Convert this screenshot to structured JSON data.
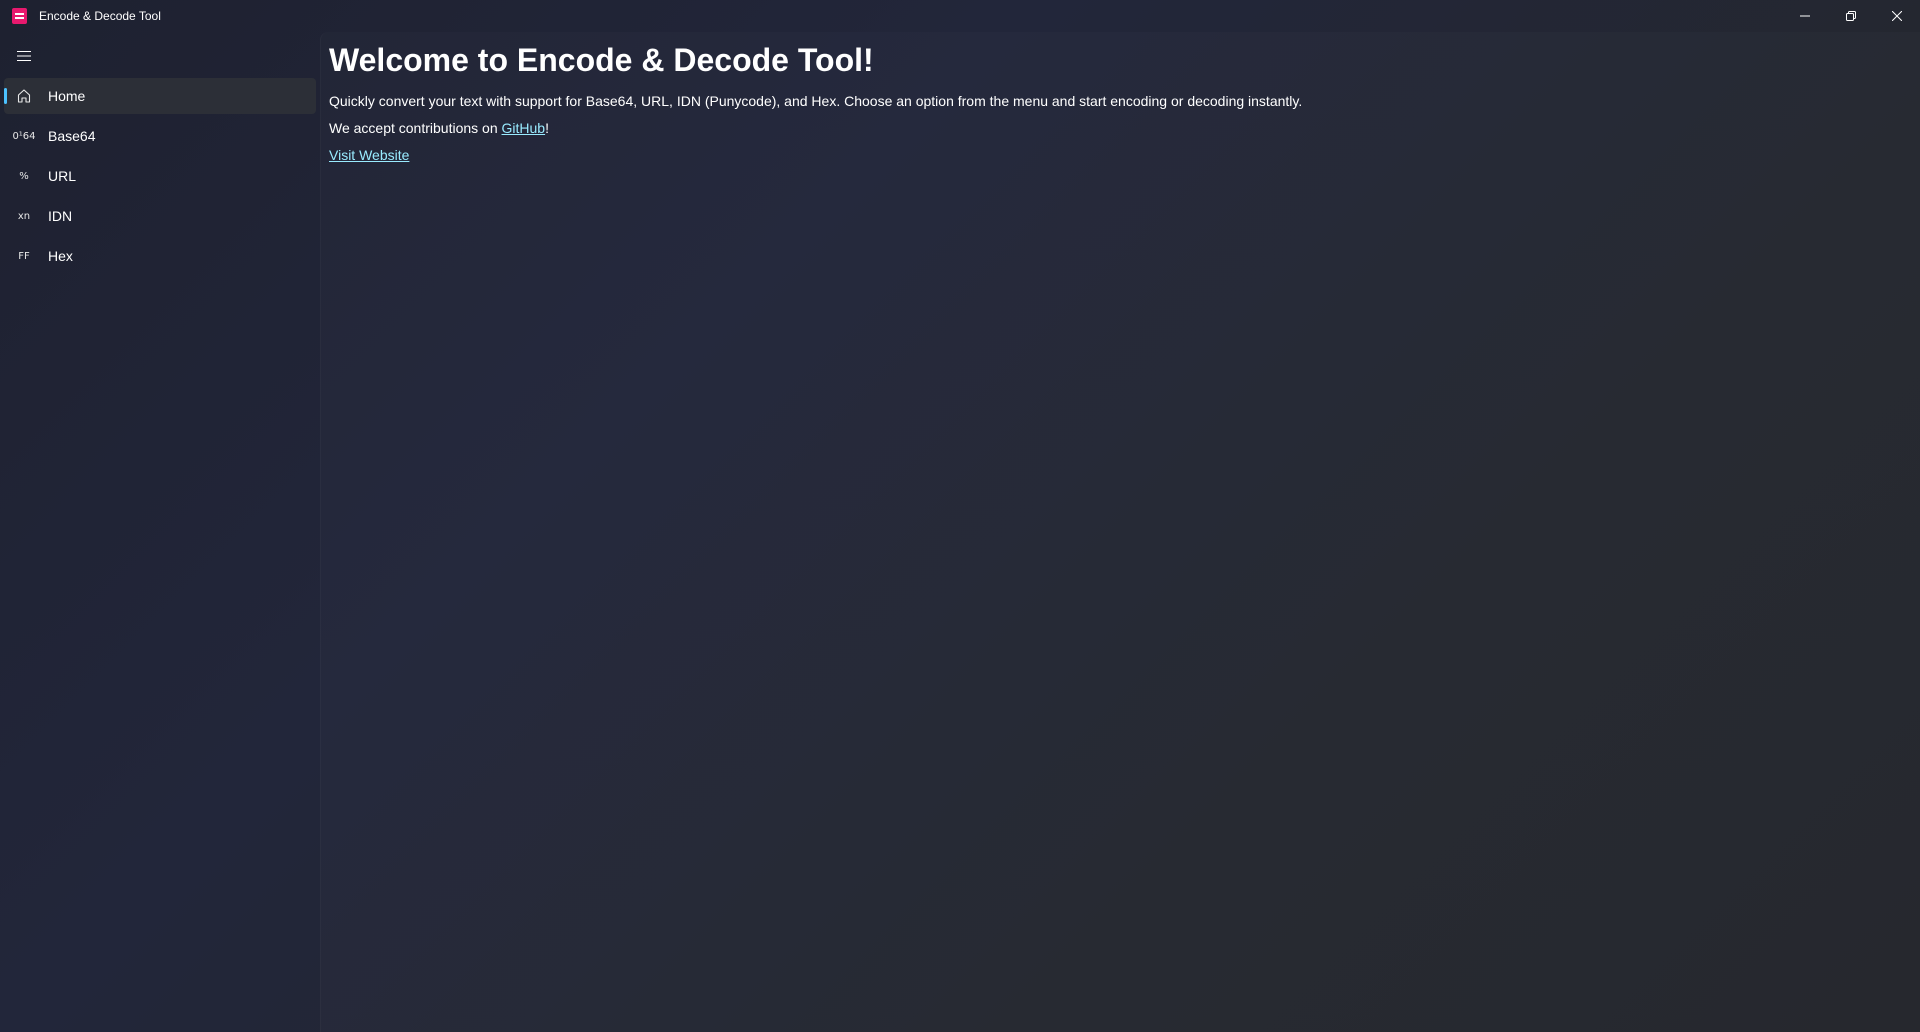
{
  "window": {
    "title": "Encode & Decode Tool",
    "caption": {
      "minimize_icon": "minimize-icon",
      "restore_icon": "restore-icon",
      "close_icon": "close-icon"
    }
  },
  "sidebar": {
    "menu_icon": "hamburger-icon",
    "items": [
      {
        "id": "home",
        "label": "Home",
        "icon": "home-icon",
        "glyph": "",
        "selected": true
      },
      {
        "id": "base64",
        "label": "Base64",
        "icon": "base64-icon",
        "glyph": "0¹64",
        "selected": false
      },
      {
        "id": "url",
        "label": "URL",
        "icon": "percent-icon",
        "glyph": "%",
        "selected": false
      },
      {
        "id": "idn",
        "label": "IDN",
        "icon": "xn-icon",
        "glyph": "xn",
        "selected": false
      },
      {
        "id": "hex",
        "label": "Hex",
        "icon": "hex-icon",
        "glyph": "FF",
        "selected": false
      }
    ]
  },
  "main": {
    "title": "Welcome to Encode & Decode Tool!",
    "intro": "Quickly convert your text with support for Base64, URL, IDN (Punycode), and Hex. Choose an option from the menu and start encoding or decoding instantly.",
    "contrib_prefix": "We accept contributions on ",
    "contrib_link": "GitHub",
    "contrib_suffix": "!",
    "visit_link": "Visit Website"
  },
  "colors": {
    "accent": "#4cc2ff",
    "link": "#99ebff",
    "app_icon": "#e8196e"
  }
}
